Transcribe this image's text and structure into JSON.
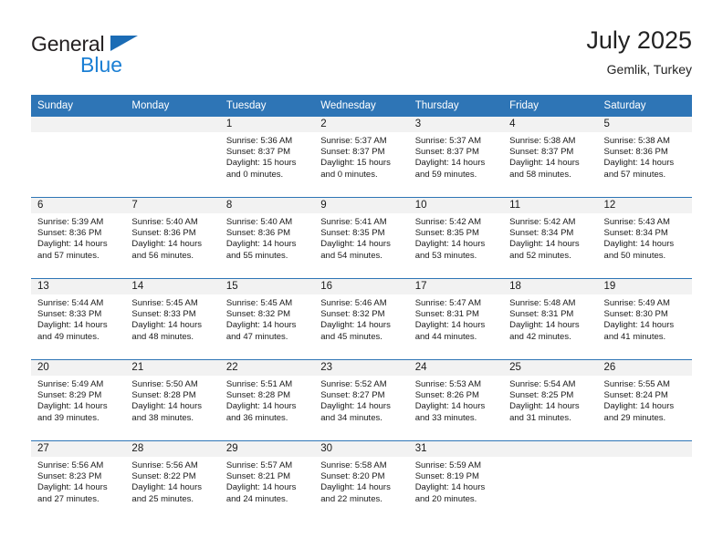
{
  "brand": {
    "line1": "General",
    "line2": "Blue",
    "triangle_color": "#1b6cb5",
    "text_color": "#231f20",
    "blue_text_color": "#1b7fd4"
  },
  "header": {
    "title": "July 2025",
    "subtitle": "Gemlik, Turkey"
  },
  "colors": {
    "header_row": "#2e75b6",
    "daynum_band": "#f2f2f2",
    "cell_divider": "#2e75b6",
    "page_background": "#ffffff"
  },
  "weekday_headers": [
    "Sunday",
    "Monday",
    "Tuesday",
    "Wednesday",
    "Thursday",
    "Friday",
    "Saturday"
  ],
  "labels": {
    "sunrise_prefix": "Sunrise:",
    "sunset_prefix": "Sunset:",
    "daylight_prefix": "Daylight:"
  },
  "weeks": [
    [
      {
        "day": "",
        "sunrise": "",
        "sunset": "",
        "daylight_1": "",
        "daylight_2": ""
      },
      {
        "day": "",
        "sunrise": "",
        "sunset": "",
        "daylight_1": "",
        "daylight_2": ""
      },
      {
        "day": "1",
        "sunrise": "Sunrise: 5:36 AM",
        "sunset": "Sunset: 8:37 PM",
        "daylight_1": "Daylight: 15 hours",
        "daylight_2": "and 0 minutes."
      },
      {
        "day": "2",
        "sunrise": "Sunrise: 5:37 AM",
        "sunset": "Sunset: 8:37 PM",
        "daylight_1": "Daylight: 15 hours",
        "daylight_2": "and 0 minutes."
      },
      {
        "day": "3",
        "sunrise": "Sunrise: 5:37 AM",
        "sunset": "Sunset: 8:37 PM",
        "daylight_1": "Daylight: 14 hours",
        "daylight_2": "and 59 minutes."
      },
      {
        "day": "4",
        "sunrise": "Sunrise: 5:38 AM",
        "sunset": "Sunset: 8:37 PM",
        "daylight_1": "Daylight: 14 hours",
        "daylight_2": "and 58 minutes."
      },
      {
        "day": "5",
        "sunrise": "Sunrise: 5:38 AM",
        "sunset": "Sunset: 8:36 PM",
        "daylight_1": "Daylight: 14 hours",
        "daylight_2": "and 57 minutes."
      }
    ],
    [
      {
        "day": "6",
        "sunrise": "Sunrise: 5:39 AM",
        "sunset": "Sunset: 8:36 PM",
        "daylight_1": "Daylight: 14 hours",
        "daylight_2": "and 57 minutes."
      },
      {
        "day": "7",
        "sunrise": "Sunrise: 5:40 AM",
        "sunset": "Sunset: 8:36 PM",
        "daylight_1": "Daylight: 14 hours",
        "daylight_2": "and 56 minutes."
      },
      {
        "day": "8",
        "sunrise": "Sunrise: 5:40 AM",
        "sunset": "Sunset: 8:36 PM",
        "daylight_1": "Daylight: 14 hours",
        "daylight_2": "and 55 minutes."
      },
      {
        "day": "9",
        "sunrise": "Sunrise: 5:41 AM",
        "sunset": "Sunset: 8:35 PM",
        "daylight_1": "Daylight: 14 hours",
        "daylight_2": "and 54 minutes."
      },
      {
        "day": "10",
        "sunrise": "Sunrise: 5:42 AM",
        "sunset": "Sunset: 8:35 PM",
        "daylight_1": "Daylight: 14 hours",
        "daylight_2": "and 53 minutes."
      },
      {
        "day": "11",
        "sunrise": "Sunrise: 5:42 AM",
        "sunset": "Sunset: 8:34 PM",
        "daylight_1": "Daylight: 14 hours",
        "daylight_2": "and 52 minutes."
      },
      {
        "day": "12",
        "sunrise": "Sunrise: 5:43 AM",
        "sunset": "Sunset: 8:34 PM",
        "daylight_1": "Daylight: 14 hours",
        "daylight_2": "and 50 minutes."
      }
    ],
    [
      {
        "day": "13",
        "sunrise": "Sunrise: 5:44 AM",
        "sunset": "Sunset: 8:33 PM",
        "daylight_1": "Daylight: 14 hours",
        "daylight_2": "and 49 minutes."
      },
      {
        "day": "14",
        "sunrise": "Sunrise: 5:45 AM",
        "sunset": "Sunset: 8:33 PM",
        "daylight_1": "Daylight: 14 hours",
        "daylight_2": "and 48 minutes."
      },
      {
        "day": "15",
        "sunrise": "Sunrise: 5:45 AM",
        "sunset": "Sunset: 8:32 PM",
        "daylight_1": "Daylight: 14 hours",
        "daylight_2": "and 47 minutes."
      },
      {
        "day": "16",
        "sunrise": "Sunrise: 5:46 AM",
        "sunset": "Sunset: 8:32 PM",
        "daylight_1": "Daylight: 14 hours",
        "daylight_2": "and 45 minutes."
      },
      {
        "day": "17",
        "sunrise": "Sunrise: 5:47 AM",
        "sunset": "Sunset: 8:31 PM",
        "daylight_1": "Daylight: 14 hours",
        "daylight_2": "and 44 minutes."
      },
      {
        "day": "18",
        "sunrise": "Sunrise: 5:48 AM",
        "sunset": "Sunset: 8:31 PM",
        "daylight_1": "Daylight: 14 hours",
        "daylight_2": "and 42 minutes."
      },
      {
        "day": "19",
        "sunrise": "Sunrise: 5:49 AM",
        "sunset": "Sunset: 8:30 PM",
        "daylight_1": "Daylight: 14 hours",
        "daylight_2": "and 41 minutes."
      }
    ],
    [
      {
        "day": "20",
        "sunrise": "Sunrise: 5:49 AM",
        "sunset": "Sunset: 8:29 PM",
        "daylight_1": "Daylight: 14 hours",
        "daylight_2": "and 39 minutes."
      },
      {
        "day": "21",
        "sunrise": "Sunrise: 5:50 AM",
        "sunset": "Sunset: 8:28 PM",
        "daylight_1": "Daylight: 14 hours",
        "daylight_2": "and 38 minutes."
      },
      {
        "day": "22",
        "sunrise": "Sunrise: 5:51 AM",
        "sunset": "Sunset: 8:28 PM",
        "daylight_1": "Daylight: 14 hours",
        "daylight_2": "and 36 minutes."
      },
      {
        "day": "23",
        "sunrise": "Sunrise: 5:52 AM",
        "sunset": "Sunset: 8:27 PM",
        "daylight_1": "Daylight: 14 hours",
        "daylight_2": "and 34 minutes."
      },
      {
        "day": "24",
        "sunrise": "Sunrise: 5:53 AM",
        "sunset": "Sunset: 8:26 PM",
        "daylight_1": "Daylight: 14 hours",
        "daylight_2": "and 33 minutes."
      },
      {
        "day": "25",
        "sunrise": "Sunrise: 5:54 AM",
        "sunset": "Sunset: 8:25 PM",
        "daylight_1": "Daylight: 14 hours",
        "daylight_2": "and 31 minutes."
      },
      {
        "day": "26",
        "sunrise": "Sunrise: 5:55 AM",
        "sunset": "Sunset: 8:24 PM",
        "daylight_1": "Daylight: 14 hours",
        "daylight_2": "and 29 minutes."
      }
    ],
    [
      {
        "day": "27",
        "sunrise": "Sunrise: 5:56 AM",
        "sunset": "Sunset: 8:23 PM",
        "daylight_1": "Daylight: 14 hours",
        "daylight_2": "and 27 minutes."
      },
      {
        "day": "28",
        "sunrise": "Sunrise: 5:56 AM",
        "sunset": "Sunset: 8:22 PM",
        "daylight_1": "Daylight: 14 hours",
        "daylight_2": "and 25 minutes."
      },
      {
        "day": "29",
        "sunrise": "Sunrise: 5:57 AM",
        "sunset": "Sunset: 8:21 PM",
        "daylight_1": "Daylight: 14 hours",
        "daylight_2": "and 24 minutes."
      },
      {
        "day": "30",
        "sunrise": "Sunrise: 5:58 AM",
        "sunset": "Sunset: 8:20 PM",
        "daylight_1": "Daylight: 14 hours",
        "daylight_2": "and 22 minutes."
      },
      {
        "day": "31",
        "sunrise": "Sunrise: 5:59 AM",
        "sunset": "Sunset: 8:19 PM",
        "daylight_1": "Daylight: 14 hours",
        "daylight_2": "and 20 minutes."
      },
      {
        "day": "",
        "sunrise": "",
        "sunset": "",
        "daylight_1": "",
        "daylight_2": ""
      },
      {
        "day": "",
        "sunrise": "",
        "sunset": "",
        "daylight_1": "",
        "daylight_2": ""
      }
    ]
  ]
}
